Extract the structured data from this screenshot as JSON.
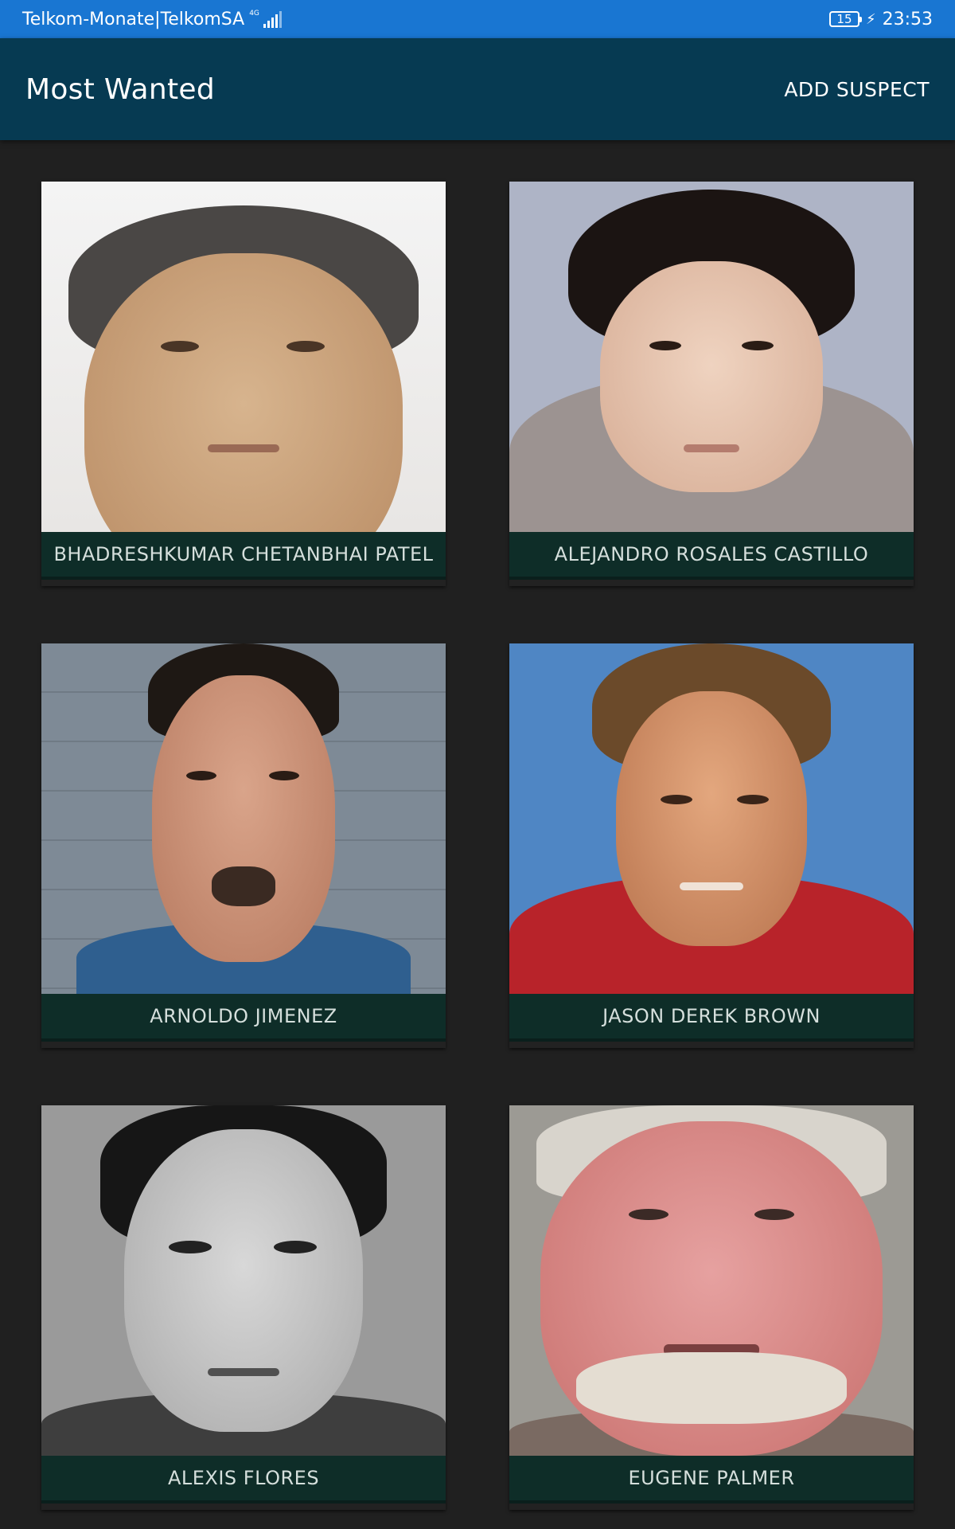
{
  "status_bar": {
    "carrier": "Telkom-Monate|TelkomSA",
    "network": "4G",
    "battery": "15",
    "time": "23:53"
  },
  "app_bar": {
    "title": "Most Wanted",
    "action_label": "ADD SUSPECT"
  },
  "suspects": [
    {
      "name": "BHADRESHKUMAR CHETANBHAI PATEL"
    },
    {
      "name": "ALEJANDRO ROSALES CASTILLO"
    },
    {
      "name": "ARNOLDO JIMENEZ"
    },
    {
      "name": "JASON DEREK BROWN"
    },
    {
      "name": "ALEXIS FLORES"
    },
    {
      "name": "EUGENE PALMER"
    }
  ],
  "colors": {
    "status_bar": "#1976d2",
    "app_bar": "#063a52",
    "background": "#202020",
    "caption_bg": "#0e2d28",
    "caption_text": "#d5dfdc"
  }
}
